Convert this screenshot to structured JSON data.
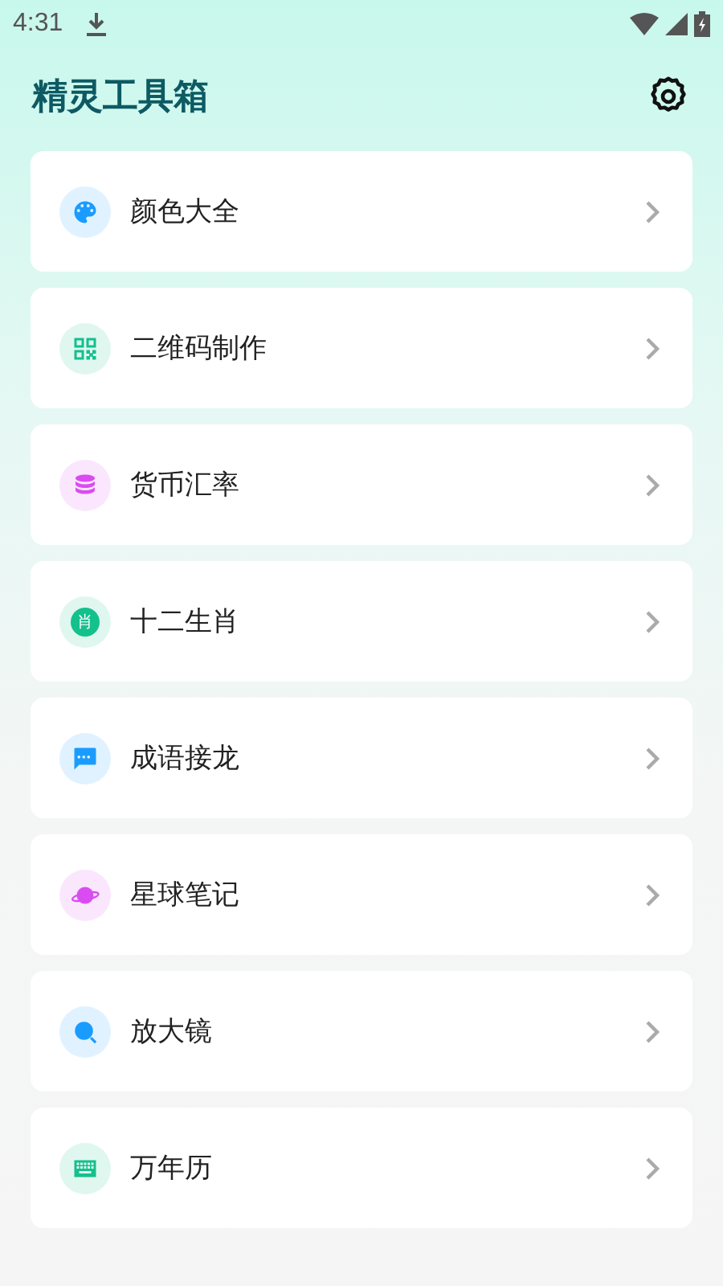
{
  "status_bar": {
    "time": "4:31"
  },
  "header": {
    "title": "精灵工具箱"
  },
  "tools": [
    {
      "label": "颜色大全",
      "kind": "palette",
      "color": "#1a9cff"
    },
    {
      "label": "二维码制作",
      "kind": "qr",
      "color": "#14c08c"
    },
    {
      "label": "货币汇率",
      "kind": "coins",
      "color": "#d94cf0"
    },
    {
      "label": "十二生肖",
      "kind": "badge",
      "color": "#14c08c",
      "icon_text": "肖"
    },
    {
      "label": "成语接龙",
      "kind": "chat",
      "color": "#1a9cff"
    },
    {
      "label": "星球笔记",
      "kind": "planet",
      "color": "#d94cf0"
    },
    {
      "label": "放大镜",
      "kind": "search",
      "color": "#1a9cff"
    },
    {
      "label": "万年历",
      "kind": "keyboard",
      "color": "#14c08c"
    }
  ]
}
